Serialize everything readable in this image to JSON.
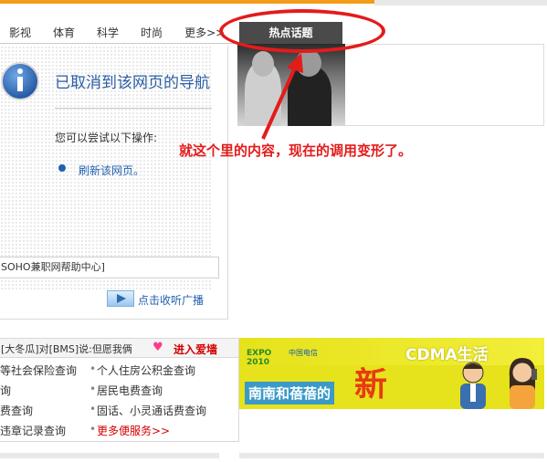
{
  "nav": {
    "items": [
      "影视",
      "体育",
      "科学",
      "时尚",
      "更多>>"
    ],
    "hot_tab": "热点话题"
  },
  "error_page": {
    "title": "已取消到该网页的导航",
    "try_text": "您可以尝试以下操作:",
    "refresh_link": "刷新该网页。"
  },
  "soho_link": "SOHO兼职网帮助中心]",
  "radio_link": "点击收听广播",
  "annotation": {
    "text": "就这个里的内容，现在的调用变形了。",
    "color": "#e41b1b"
  },
  "ticker": {
    "text": "[大冬瓜]对[BMS]说:但愿我俩",
    "enter_link": "进入爱墙"
  },
  "services": {
    "left": [
      "等社会保险查询",
      "询",
      "费查询",
      "违章记录查询"
    ],
    "right": [
      "个人住房公积金查询",
      "居民电费查询",
      "固话、小灵通话费查询",
      "更多便服务>>"
    ]
  },
  "banner": {
    "title": "CDMA生活",
    "big_char": "新",
    "slogan": "南南和蓓蓓的",
    "expo_text": "EXPO 2010",
    "carrier_text": "中国电信"
  },
  "colors": {
    "accent_blue": "#2260b0",
    "link_red": "#d40000",
    "banner_yellow": "#e6e21b",
    "tab_dark": "#4a4a4a"
  }
}
